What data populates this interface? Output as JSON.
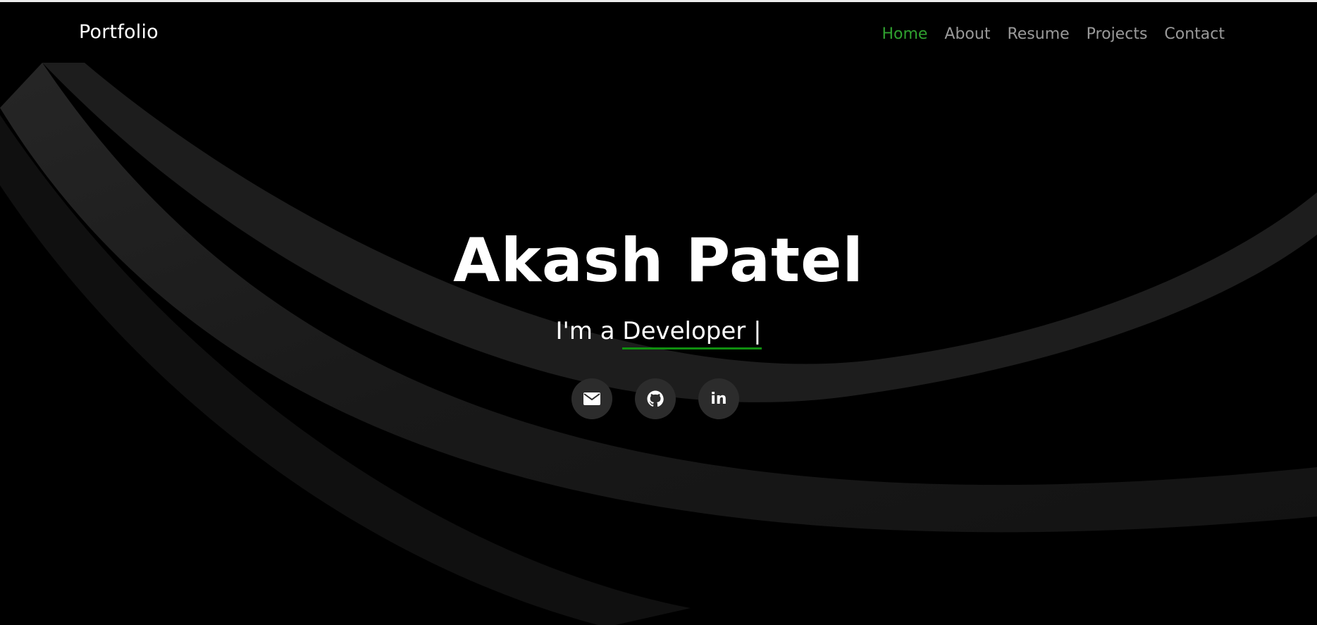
{
  "navbar": {
    "brand": "Portfolio",
    "links": [
      {
        "label": "Home",
        "active": true
      },
      {
        "label": "About",
        "active": false
      },
      {
        "label": "Resume",
        "active": false
      },
      {
        "label": "Projects",
        "active": false
      },
      {
        "label": "Contact",
        "active": false
      }
    ]
  },
  "hero": {
    "name": "Akash Patel",
    "prefix": "I'm a",
    "role": "Developer |",
    "socials": [
      {
        "icon": "email-icon"
      },
      {
        "icon": "github-icon"
      },
      {
        "icon": "linkedin-icon",
        "glyph": "in"
      }
    ]
  },
  "colors": {
    "accent": "#2fa12f",
    "underline": "#0f8f0f",
    "background": "#000000",
    "nav_text": "#9a9a9a",
    "social_bg": "#2c2c2c"
  }
}
